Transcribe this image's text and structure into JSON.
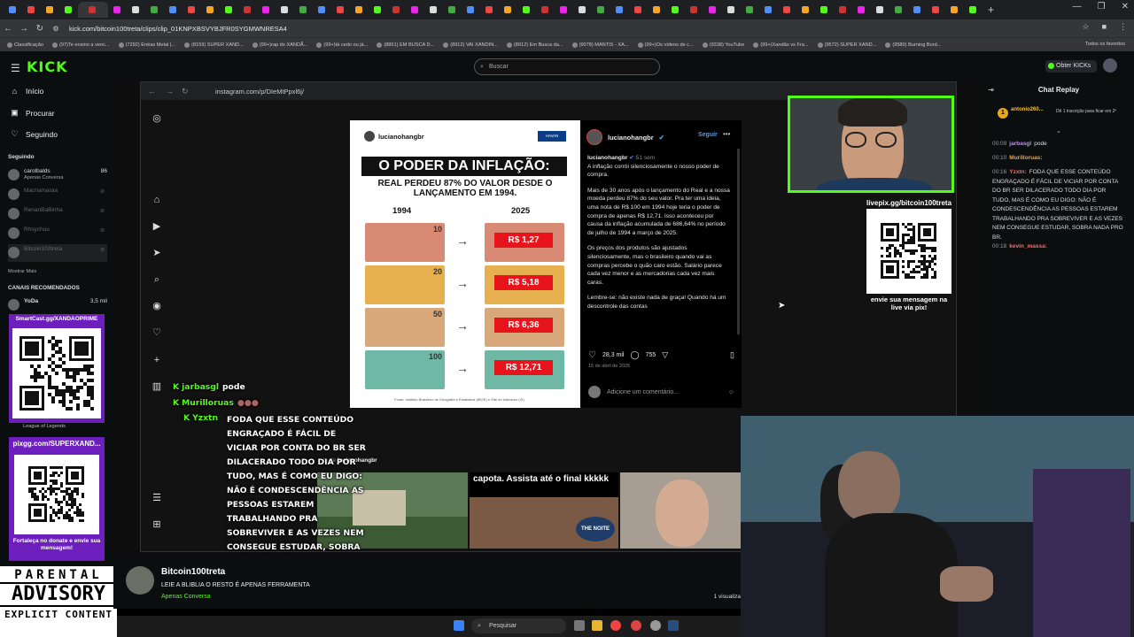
{
  "browser": {
    "url": "kick.com/bitcoin100treta/clips/clip_01KNPXBSVYBJFR0SYGMWNRESA4",
    "bookmarks": [
      "Classificação",
      "(97)Te ensino a venc...",
      "(7292) Enéas Metal |...",
      "(8159) SUPER XAND...",
      "(99+)rap do XANDÃ...",
      "(99+)tá cedo ou já...",
      "(8851) EM BUSCA D...",
      "(8912) VAI XANDIN...",
      "(8912) Em Busca da...",
      "(9078) MANTIS - XA...",
      "(99+)Os vídeos de c...",
      "(9338) YouTube",
      "(99+)Xandão vs Fra...",
      "(9572) SUPER XAND...",
      "(9580) Burning Bord..."
    ],
    "bookmarks_all": "Todos os favoritos",
    "new_tab": "+",
    "window_controls": [
      "—",
      "❐",
      "✕"
    ]
  },
  "kick": {
    "logo": "KICK",
    "search_placeholder": "Buscar",
    "obter": "Obter KICKs",
    "nav": [
      "Início",
      "Procurar",
      "Seguindo"
    ],
    "following_label": "Seguindo",
    "following": [
      {
        "name": "carolbalds",
        "sub": "Apenas Conversa",
        "count": "86",
        "live": true
      },
      {
        "name": "Macnamaraa",
        "live": false
      },
      {
        "name": "RenanBaBinha",
        "live": false
      },
      {
        "name": "Rhsychuu",
        "live": false
      },
      {
        "name": "Bitcoin100treta",
        "live": false
      }
    ],
    "show_more": "Mostrar Mais",
    "recommended_label": "CANAIS RECOMENDADOS",
    "recommended": [
      {
        "name": "YoDa",
        "count": "3,5 mil"
      }
    ],
    "league": "League of Legends",
    "promo1": "SmartCast.gg/XANDAOPRIME",
    "promo2": "pixgg.com/SUPERXAND...",
    "promo2_foot": "Fortaleça no donate e envie sua mensagem!",
    "parental": [
      "PARENTAL",
      "ADVISORY",
      "EXPLICIT CONTENT"
    ]
  },
  "inner_browser": {
    "url": "instagram.com/p/DIeMtPpxl6j/"
  },
  "instagram_post": {
    "handle": "lucianohangbr",
    "badge": "HAVAN",
    "title": "O PODER DA INFLAÇÃO:",
    "subtitle": "REAL PERDEU 87% DO VALOR DESDE O LANÇAMENTO EM 1994.",
    "year_from": "1994",
    "year_to": "2025",
    "rows": [
      {
        "note": "10",
        "price": "R$ 1,27",
        "color": "#d98a74"
      },
      {
        "note": "20",
        "price": "R$ 5,18",
        "color": "#e7b04f"
      },
      {
        "note": "50",
        "price": "R$ 6,36",
        "color": "#d8a77a"
      },
      {
        "note": "100",
        "price": "R$ 12,71",
        "color": "#6fb8a5"
      }
    ],
    "source": "Fonte: Instituto Brasileiro de Geografia e Estatística (IBGE) e Site do Indicador (IX)"
  },
  "comments": {
    "user": "lucianohangbr",
    "follow": "Seguir",
    "time": "51 sem",
    "paragraphs": [
      "A inflação corrói silenciosamente o nosso poder de compra.",
      "Mais de 30 anos após o lançamento do Real e a nossa moeda perdeu 87% do seu valor. Pra ter uma ideia, uma nota de R$ 100 em 1994 hoje teria o poder de compra de apenas R$ 12,71. Isso aconteceu por causa da inflação acumulada de 686,64% no período de julho de 1994 a março de 2025.",
      "Os preços dos produtos são ajustados silenciosamente, mas o brasileiro quando vai as compras percebe o quão caro estão. Salário parece cada vez menor e as mercadorias cada vez mais caras.",
      "Lembre-se: não existe nada de graça! Quando há um descontrole das contas"
    ],
    "likes": "28,3 mil",
    "comment_count": "755",
    "date": "15 de abril de 2025",
    "add_comment": "Adicione um comentário..."
  },
  "overlay_chat": [
    {
      "user": "jarbasgl",
      "text": "pode"
    },
    {
      "user": "Murilloruas",
      "text": ""
    },
    {
      "user": "Yzxtn",
      "text": "FODA QUE ESSE CONTEÚDO ENGRAÇADO É FÁCIL DE VICIAR POR CONTA DO BR SER DILACERADO TODO DIA POR TUDO, MAS É COMO EU DIGO: NÃO É CONDESCENDÊNCIA AS PESSOAS ESTAREM TRABALHANDO PRA SOBREVIVER E AS VEZES NEM CONSEGUE ESTUDAR, SOBRA NADA PRO BR."
    }
  ],
  "reels": {
    "label_prefix": "ts de",
    "user": "lucianohangbr",
    "caption": "capota. Assista até o final kkkkk",
    "noite": "THE NOITE"
  },
  "livepix": {
    "top": "livepix.gg/bitcoin100treta",
    "bottom": "envie sua mensagem na live via pix!"
  },
  "chat_replay": {
    "title": "Chat Replay",
    "pinned_user": "antonio260...",
    "pinned_text": "Dê 1 inscrição para ficar em 2º",
    "messages": [
      {
        "ts": "00:09",
        "user": "jarbasgl",
        "text": "pode",
        "color": "#c58af9"
      },
      {
        "ts": "00:10",
        "user": "Murilloruas:",
        "text": "",
        "color": "#f4a340"
      },
      {
        "ts": "00:16",
        "user": "Yzxtn:",
        "text": "FODA QUE ESSE CONTEÚDO ENGRAÇADO É FÁCIL DE VICIAR POR CONTA DO BR SER DILACERADO TODO DIA POR TUDO, MAS É COMO EU DIGO: NÃO É CONDESCENDÊNCIA AS PESSOAS ESTAREM TRABALHANDO PRA SOBREVIVER E AS VEZES NEM CONSEGUE ESTUDAR, SOBRA NADA PRO BR.",
        "color": "#f26b6b"
      },
      {
        "ts": "00:18",
        "user": "kevin_massa:",
        "text": "",
        "color": "#f26b6b"
      }
    ]
  },
  "channel": {
    "name": "Bitcoin100treta",
    "title": "LEIE A BLIBLIA O RESTO É APENAS FERRAMENTA",
    "category": "Apenas Conversa",
    "views": "1 visualiza"
  },
  "taskbar": {
    "search": "Pesquisar"
  },
  "colors": {
    "kick_green": "#53fc18",
    "promo_purple": "#6d1fbe",
    "price_red": "#e8141b"
  }
}
